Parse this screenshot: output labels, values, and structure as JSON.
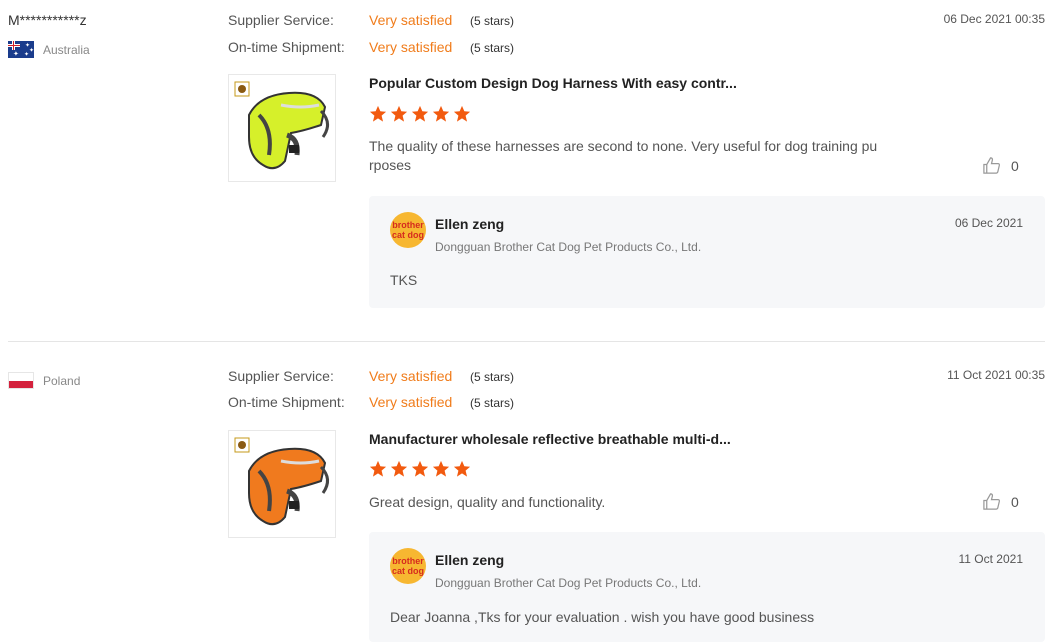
{
  "reviews": [
    {
      "buyer": "M***********z",
      "country": "Australia",
      "supplier_label": "Supplier Service:",
      "supplier_value": "Very satisfied",
      "supplier_stars": "(5 stars)",
      "shipment_label": "On-time Shipment:",
      "shipment_value": "Very satisfied",
      "shipment_stars": "(5 stars)",
      "date": "06 Dec 2021 00:35",
      "product_title": "Popular Custom Design Dog Harness With easy contr...",
      "rating": 5,
      "comment": "The quality of these harnesses are second to none. Very useful for dog training pu rposes",
      "likes": "0",
      "reply": {
        "seller": "Ellen zeng",
        "company": "Dongguan Brother Cat Dog Pet Products Co., Ltd.",
        "date": "06 Dec 2021",
        "text": "TKS"
      }
    },
    {
      "buyer": "",
      "country": "Poland",
      "supplier_label": "Supplier Service:",
      "supplier_value": "Very satisfied",
      "supplier_stars": "(5 stars)",
      "shipment_label": "On-time Shipment:",
      "shipment_value": "Very satisfied",
      "shipment_stars": "(5 stars)",
      "date": "11 Oct 2021 00:35",
      "product_title": "Manufacturer wholesale reflective breathable multi-d...",
      "rating": 5,
      "comment": "Great design, quality and functionality.",
      "likes": "0",
      "reply": {
        "seller": "Ellen zeng",
        "company": "Dongguan Brother Cat Dog Pet Products Co., Ltd.",
        "date": "11 Oct 2021",
        "text": "Dear Joanna ,Tks for your evaluation  . wish you have good business"
      }
    }
  ],
  "avatar_logo": {
    "line1": "brother",
    "line2": "cat dog"
  },
  "colors": {
    "accent": "#f07c1b",
    "star": "#f25a0f",
    "harness1": "#d6f02a",
    "harness2": "#f07a1e"
  }
}
